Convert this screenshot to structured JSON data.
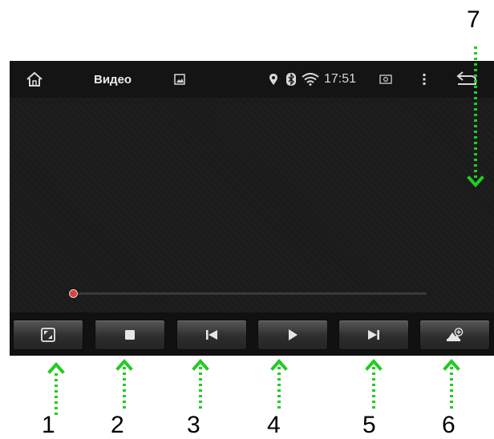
{
  "app": {
    "title": "Видео"
  },
  "status_bar": {
    "time": "17:51"
  },
  "playback": {
    "progress": 0.0
  },
  "callouts": {
    "c1": "1",
    "c2": "2",
    "c3": "3",
    "c4": "4",
    "c5": "5",
    "c6": "6",
    "c7": "7"
  },
  "colors": {
    "arrow": "#22cc22",
    "seek_thumb": "#e04040",
    "background": "#1b1b1b"
  },
  "icons": {
    "status_left": [
      "home-icon",
      "image-notification-icon"
    ],
    "status_right": [
      "location-icon",
      "bluetooth-icon",
      "wifi-icon",
      "screenshot-icon",
      "overflow-menu-icon",
      "back-icon"
    ],
    "controls": [
      "fullscreen-icon",
      "stop-icon",
      "previous-icon",
      "play-icon",
      "next-icon",
      "add-playlist-icon"
    ]
  }
}
